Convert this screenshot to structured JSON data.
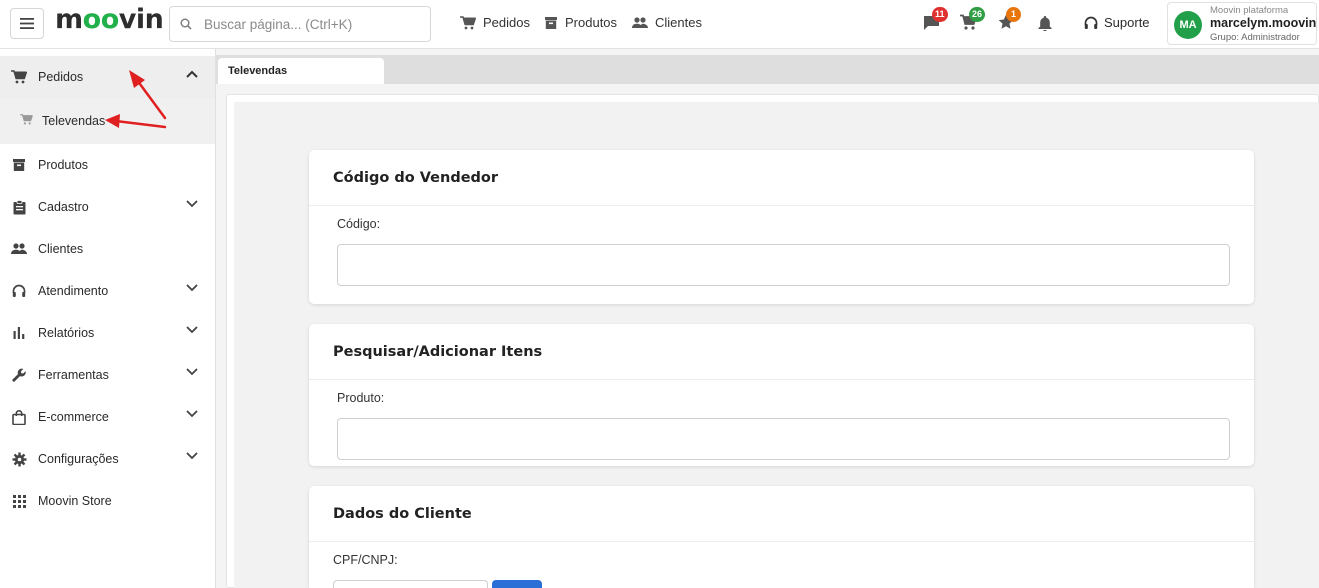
{
  "header": {
    "logo": {
      "left": "m",
      "accent": "oo",
      "right": "vin"
    },
    "search_placeholder": "Buscar página... (Ctrl+K)",
    "nav": [
      {
        "label": "Pedidos",
        "icon": "cart-icon"
      },
      {
        "label": "Produtos",
        "icon": "box-icon"
      },
      {
        "label": "Clientes",
        "icon": "people-icon"
      }
    ],
    "notifications": [
      {
        "icon": "chat-icon",
        "count": "11",
        "color": "#e03131"
      },
      {
        "icon": "cart-icon",
        "count": "26",
        "color": "#2f9e44"
      },
      {
        "icon": "star-icon",
        "count": "1",
        "color": "#e8750a"
      },
      {
        "icon": "bell-icon",
        "count": "",
        "color": ""
      }
    ],
    "support_label": "Suporte",
    "user": {
      "initials": "MA",
      "org": "Moovin plataforma",
      "name": "marcelym.moovin",
      "group": "Grupo: Administrador"
    }
  },
  "sidebar": {
    "items": [
      {
        "label": "Pedidos",
        "icon": "cart-icon",
        "expandable": true,
        "expanded": true
      },
      {
        "label": "Televendas",
        "icon": "cart-icon",
        "sub": true
      },
      {
        "label": "Produtos",
        "icon": "box-icon",
        "expandable": false
      },
      {
        "label": "Cadastro",
        "icon": "clipboard-icon",
        "expandable": true
      },
      {
        "label": "Clientes",
        "icon": "people-icon",
        "expandable": false
      },
      {
        "label": "Atendimento",
        "icon": "headset-icon",
        "expandable": true
      },
      {
        "label": "Relatórios",
        "icon": "bar-chart-icon",
        "expandable": true
      },
      {
        "label": "Ferramentas",
        "icon": "wrench-icon",
        "expandable": true
      },
      {
        "label": "E-commerce",
        "icon": "bag-icon",
        "expandable": true
      },
      {
        "label": "Configurações",
        "icon": "gear-icon",
        "expandable": true
      },
      {
        "label": "Moovin Store",
        "icon": "grid-icon",
        "expandable": false
      }
    ]
  },
  "tabs": [
    {
      "label": "Televendas",
      "active": true
    }
  ],
  "cards": [
    {
      "title": "Código do Vendedor",
      "field_label": "Código:",
      "value": ""
    },
    {
      "title": "Pesquisar/Adicionar Itens",
      "field_label": "Produto:",
      "value": ""
    },
    {
      "title": "Dados do Cliente",
      "field_label": "CPF/CNPJ:",
      "value": ""
    }
  ],
  "colors": {
    "brand_green": "#22b04b",
    "annotation_red": "#e02020",
    "primary_blue": "#2a6fd6"
  }
}
